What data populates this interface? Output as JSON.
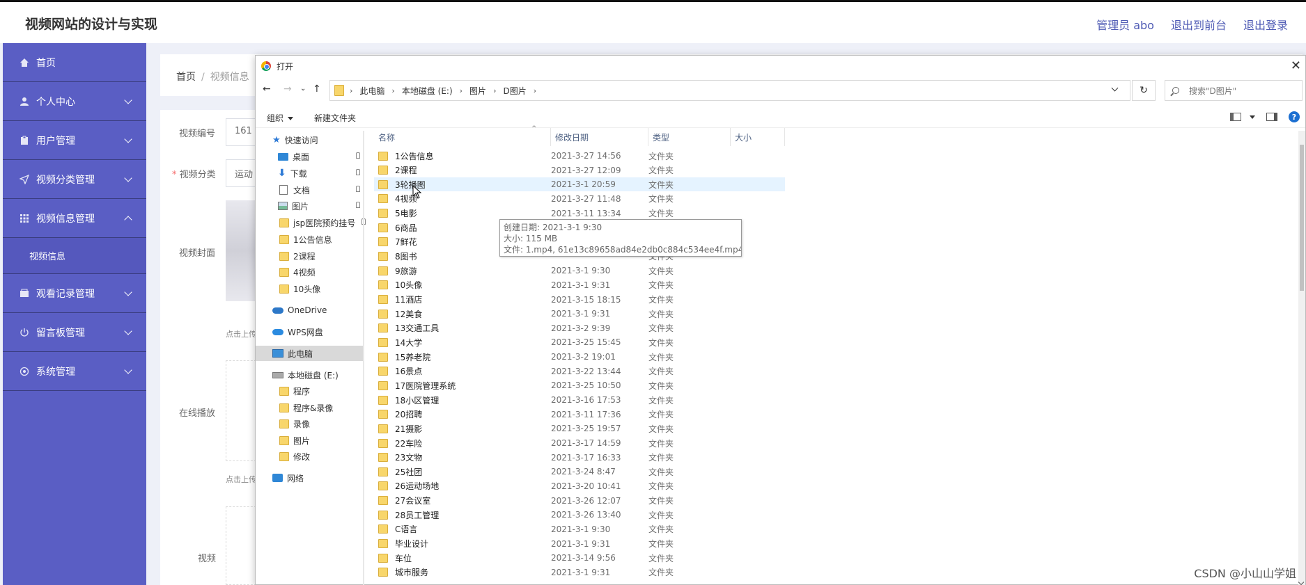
{
  "header": {
    "site_title": "视频网站的设计与实现",
    "admin_label": "管理员 abo",
    "front_link": "退出到前台",
    "logout_link": "退出登录"
  },
  "sidebar": {
    "items": [
      {
        "label": "首页",
        "icon": "home-icon"
      },
      {
        "label": "个人中心",
        "icon": "user-icon"
      },
      {
        "label": "用户管理",
        "icon": "clipboard-icon"
      },
      {
        "label": "视频分类管理",
        "icon": "send-icon"
      },
      {
        "label": "视频信息管理",
        "icon": "grid-icon"
      },
      {
        "label": "视频信息",
        "icon": ""
      },
      {
        "label": "观看记录管理",
        "icon": "wallet-icon"
      },
      {
        "label": "留言板管理",
        "icon": "power-icon"
      },
      {
        "label": "系统管理",
        "icon": "settings-icon"
      }
    ]
  },
  "breadcrumb": {
    "home": "首页",
    "sep": "/",
    "current": "视频信息"
  },
  "form": {
    "video_no_label": "视频编号",
    "video_no_value": "161",
    "category_label": "视频分类",
    "category_required": "*",
    "category_value": "运动",
    "cover_label": "视频封面",
    "upload_hint_1": "点击上传",
    "online_label": "在线播放",
    "upload_hint_2": "点击上传",
    "video_label": "视频"
  },
  "dialog": {
    "title": "打开",
    "close": "✕",
    "path": [
      "此电脑",
      "本地磁盘 (E:)",
      "图片",
      "D图片"
    ],
    "search_placeholder": "搜索\"D图片\"",
    "organize": "组织",
    "new_folder": "新建文件夹",
    "help": "?",
    "columns": {
      "name": "名称",
      "date": "修改日期",
      "type": "类型",
      "size": "大小"
    },
    "nav": {
      "quick_access": "快速访问",
      "desktop": "桌面",
      "downloads": "下载",
      "documents": "文档",
      "pictures": "图片",
      "jsp": "jsp医院预约挂号",
      "f1": "1公告信息",
      "f2": "2课程",
      "f4": "4视频",
      "f10": "10头像",
      "onedrive": "OneDrive",
      "wps": "WPS网盘",
      "this_pc": "此电脑",
      "disk_e": "本地磁盘 (E:)",
      "program": "程序",
      "program_rec": "程序&录像",
      "recording": "录像",
      "pictures2": "图片",
      "modify": "修改",
      "network": "网络"
    },
    "files": [
      {
        "name": "1公告信息",
        "date": "2021-3-27 14:56",
        "type": "文件夹"
      },
      {
        "name": "2课程",
        "date": "2021-3-27 12:09",
        "type": "文件夹"
      },
      {
        "name": "3轮播图",
        "date": "2021-3-1 20:59",
        "type": "文件夹"
      },
      {
        "name": "4视频",
        "date": "2021-3-27 11:48",
        "type": "文件夹"
      },
      {
        "name": "5电影",
        "date": "2021-3-11 13:34",
        "type": "文件夹"
      },
      {
        "name": "6商品",
        "date": "",
        "type": "文件夹"
      },
      {
        "name": "7鲜花",
        "date": "",
        "type": "文件夹"
      },
      {
        "name": "8图书",
        "date": "",
        "type": "文件夹"
      },
      {
        "name": "9旅游",
        "date": "2021-3-1 9:30",
        "type": "文件夹"
      },
      {
        "name": "10头像",
        "date": "2021-3-1 9:31",
        "type": "文件夹"
      },
      {
        "name": "11酒店",
        "date": "2021-3-15 18:15",
        "type": "文件夹"
      },
      {
        "name": "12美食",
        "date": "2021-3-1 9:31",
        "type": "文件夹"
      },
      {
        "name": "13交通工具",
        "date": "2021-3-2 9:39",
        "type": "文件夹"
      },
      {
        "name": "14大学",
        "date": "2021-3-25 15:45",
        "type": "文件夹"
      },
      {
        "name": "15养老院",
        "date": "2021-3-2 19:01",
        "type": "文件夹"
      },
      {
        "name": "16景点",
        "date": "2021-3-22 13:44",
        "type": "文件夹"
      },
      {
        "name": "17医院管理系统",
        "date": "2021-3-25 10:50",
        "type": "文件夹"
      },
      {
        "name": "18小区管理",
        "date": "2021-3-16 17:53",
        "type": "文件夹"
      },
      {
        "name": "20招聘",
        "date": "2021-3-11 17:36",
        "type": "文件夹"
      },
      {
        "name": "21摄影",
        "date": "2021-3-25 19:57",
        "type": "文件夹"
      },
      {
        "name": "22车险",
        "date": "2021-3-17 14:59",
        "type": "文件夹"
      },
      {
        "name": "23文物",
        "date": "2021-3-17 16:33",
        "type": "文件夹"
      },
      {
        "name": "25社团",
        "date": "2021-3-24 8:47",
        "type": "文件夹"
      },
      {
        "name": "26运动场地",
        "date": "2021-3-20 10:41",
        "type": "文件夹"
      },
      {
        "name": "27会议室",
        "date": "2021-3-26 12:07",
        "type": "文件夹"
      },
      {
        "name": "28员工管理",
        "date": "2021-3-26 13:40",
        "type": "文件夹"
      },
      {
        "name": "C语言",
        "date": "2021-3-1 9:30",
        "type": "文件夹"
      },
      {
        "name": "毕业设计",
        "date": "2021-3-1 9:31",
        "type": "文件夹"
      },
      {
        "name": "车位",
        "date": "2021-3-14 9:56",
        "type": "文件夹"
      },
      {
        "name": "城市服务",
        "date": "2021-3-1 9:31",
        "type": "文件夹"
      }
    ],
    "tooltip": {
      "created": "创建日期: 2021-3-1 9:30",
      "size": "大小: 115 MB",
      "files": "文件: 1.mp4, 61e13c89658ad84e2db0c884c534ee4f.mp4, ..."
    }
  },
  "watermark": "CSDN @小山山学姐",
  "colors": {
    "sidebar": "#5a5ec4",
    "accent": "#4e5ab4",
    "folder": "#f8d66b",
    "highlight": "#e5f3ff"
  }
}
